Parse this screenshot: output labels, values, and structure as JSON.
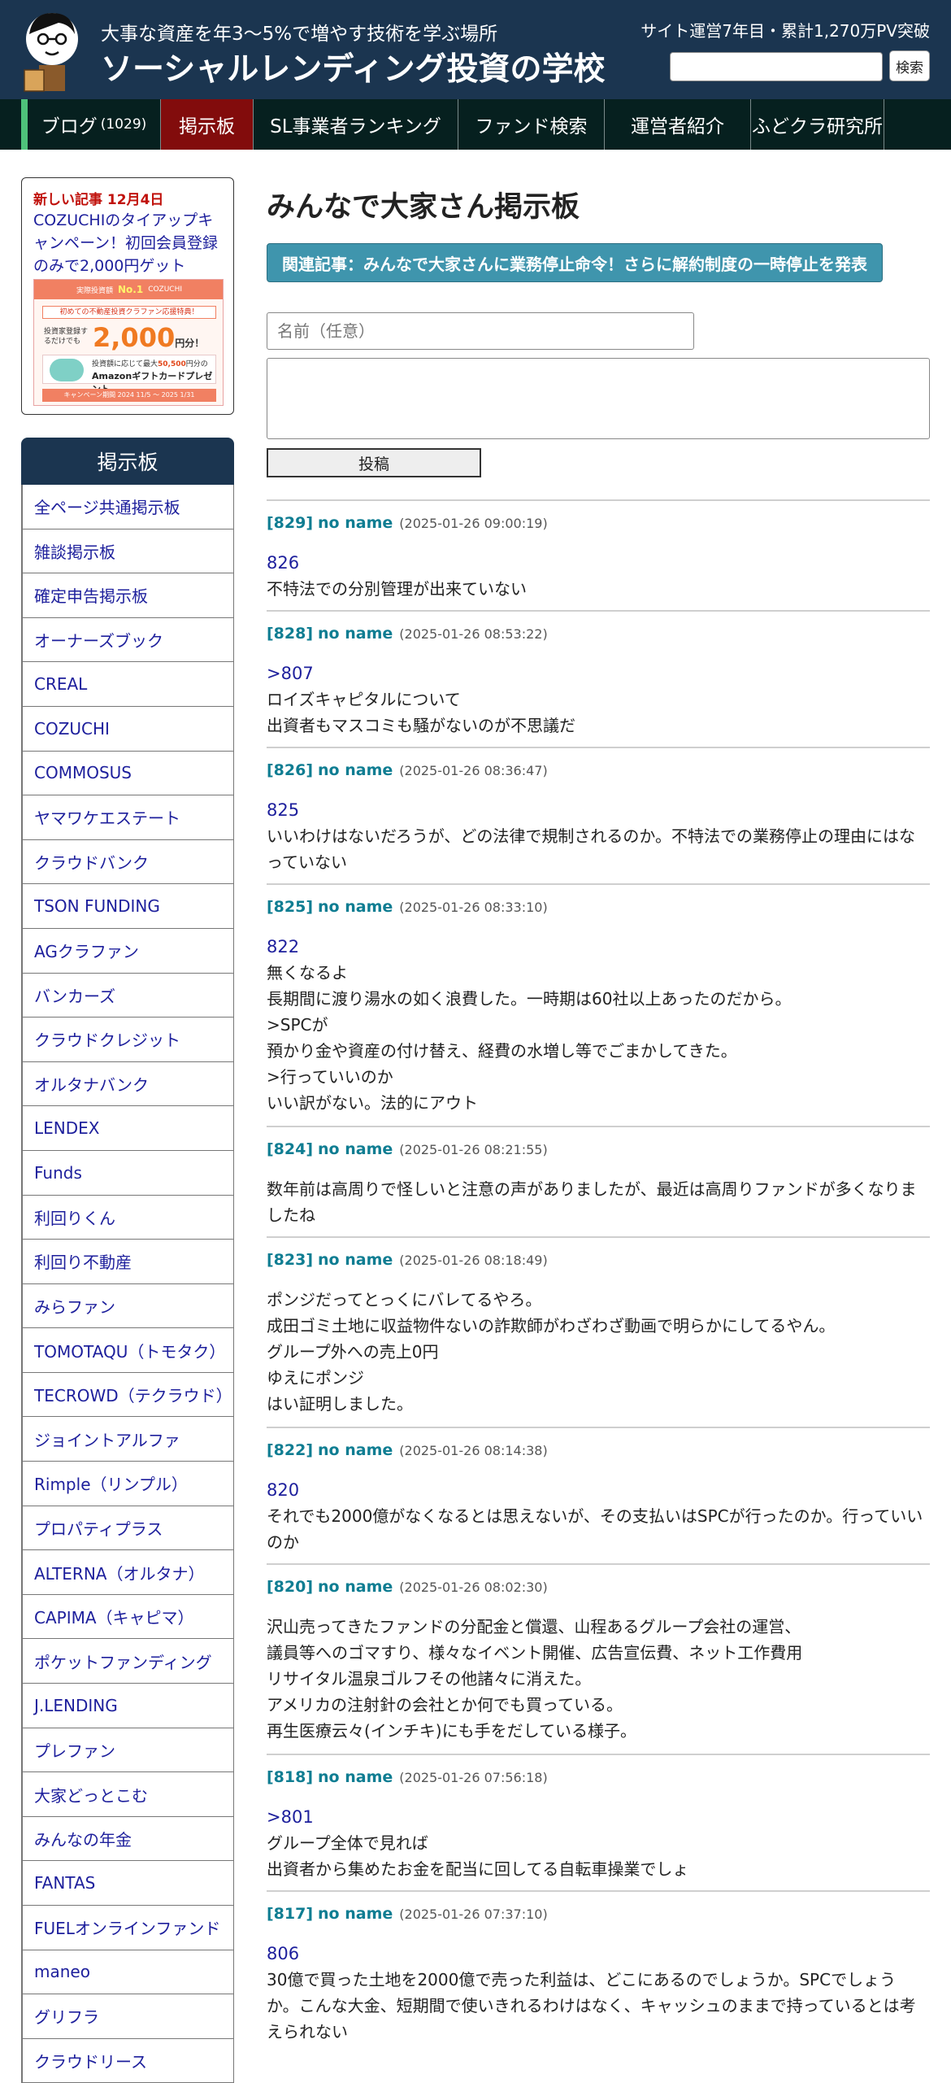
{
  "header": {
    "tagline": "大事な資産を年3〜5%で増やす技術を学ぶ場所",
    "site_title": "ソーシャルレンディング投資の学校",
    "stats": "サイト運営7年目・累計1,270万PV突破",
    "search_placeholder": "",
    "search_button": "検索"
  },
  "nav": {
    "items": [
      {
        "label": "ブログ",
        "count": "(1029)"
      },
      {
        "label": "掲示板",
        "active": true
      },
      {
        "label": "SL事業者ランキング"
      },
      {
        "label": "ファンド検索"
      },
      {
        "label": "運営者紹介"
      },
      {
        "label": "ふどクラ研究所"
      }
    ],
    "accent_color": "#4ec27a",
    "active_color": "#820c0c"
  },
  "sidebar": {
    "promo": {
      "date": "新しい記事 12月4日",
      "text": "COZUCHIのタイアップキャンペーン！初回会員登録のみで2,000円ゲット",
      "banner": {
        "top_small": "実際投資額",
        "top_badge": "No.1",
        "brand": "COZUCHI",
        "line": "初めての不動産投資クラファン応援特典！",
        "register_label": "投資家登録するだけでも",
        "amount": "2,000",
        "amount_unit": "円分！",
        "gift_line": "投資額に応じて最大",
        "gift_amount": "50,500",
        "gift_line2": "円分の",
        "gift_name": "Amazonギフトカードプレゼント",
        "footer": "キャンペーン期間 2024 11/5 〜 2025 1/31"
      }
    },
    "board": {
      "title": "掲示板",
      "items": [
        "全ページ共通掲示板",
        "雑談掲示板",
        "確定申告掲示板",
        "オーナーズブック",
        "CREAL",
        "COZUCHI",
        "COMMOSUS",
        "ヤマワケエステート",
        "クラウドバンク",
        "TSON FUNDING",
        "AGクラファン",
        "バンカーズ",
        "クラウドクレジット",
        "オルタナバンク",
        "LENDEX",
        "Funds",
        "利回りくん",
        "利回り不動産",
        "みらファン",
        "TOMOTAQU（トモタク）",
        "TECROWD（テクラウド）",
        "ジョイントアルファ",
        "Rimple（リンプル）",
        "プロパティプラス",
        "ALTERNA（オルタナ）",
        "CAPIMA（キャピマ）",
        "ポケットファンディング",
        "J.LENDING",
        "プレファン",
        "大家どっとこむ",
        "みんなの年金",
        "FANTAS",
        "FUELオンラインファンド",
        "maneo",
        "グリフラ",
        "クラウドリース"
      ]
    }
  },
  "main": {
    "title": "みんなで大家さん掲示板",
    "related": "関連記事：みんなで大家さんに業務停止命令！さらに解約制度の一時停止を発表",
    "name_placeholder": "名前（任意）",
    "post_button": "投稿",
    "comments": [
      {
        "id": "[829]",
        "name": "no name",
        "date": "(2025-01-26 09:00:19)",
        "ref": "826",
        "lines": [
          "不特法での分別管理が出来ていない"
        ]
      },
      {
        "id": "[828]",
        "name": "no name",
        "date": "(2025-01-26 08:53:22)",
        "ref": ">807",
        "lines": [
          "ロイズキャピタルについて",
          "出資者もマスコミも騒がないのが不思議だ"
        ]
      },
      {
        "id": "[826]",
        "name": "no name",
        "date": "(2025-01-26 08:36:47)",
        "ref": "825",
        "lines": [
          "いいわけはないだろうが、どの法律で規制されるのか。不特法での業務停止の理由にはな",
          "っていない"
        ]
      },
      {
        "id": "[825]",
        "name": "no name",
        "date": "(2025-01-26 08:33:10)",
        "ref": "822",
        "lines": [
          "無くなるよ",
          "長期間に渡り湯水の如く浪費した。一時期は60社以上あったのだから。",
          ">SPCが",
          "預かり金や資産の付け替え、経費の水増し等でごまかしてきた。",
          ">行っていいのか",
          "いい訳がない。法的にアウト"
        ]
      },
      {
        "id": "[824]",
        "name": "no name",
        "date": "(2025-01-26 08:21:55)",
        "ref": "",
        "lines": [
          "数年前は高周りで怪しいと注意の声がありましたが、最近は高周りファンドが多くなりま",
          "したね"
        ]
      },
      {
        "id": "[823]",
        "name": "no name",
        "date": "(2025-01-26 08:18:49)",
        "ref": "",
        "lines": [
          "ポンジだってとっくにバレてるやろ。",
          "成田ゴミ土地に収益物件ないの詐欺師がわざわざ動画で明らかにしてるやん。",
          "グループ外への売上0円",
          "ゆえにポンジ",
          "はい証明しました。"
        ]
      },
      {
        "id": "[822]",
        "name": "no name",
        "date": "(2025-01-26 08:14:38)",
        "ref": "820",
        "lines": [
          "それでも2000億がなくなるとは思えないが、その支払いはSPCが行ったのか。行っていい",
          "のか"
        ]
      },
      {
        "id": "[820]",
        "name": "no name",
        "date": "(2025-01-26 08:02:30)",
        "ref": "",
        "lines": [
          "沢山売ってきたファンドの分配金と償還、山程あるグループ会社の運営、",
          "議員等へのゴマすり、様々なイベント開催、広告宣伝費、ネット工作費用",
          "リサイタル温泉ゴルフその他諸々に消えた。",
          "アメリカの注射針の会社とか何でも買っている。",
          "再生医療云々(インチキ)にも手をだしている様子。"
        ]
      },
      {
        "id": "[818]",
        "name": "no name",
        "date": "(2025-01-26 07:56:18)",
        "ref": ">801",
        "lines": [
          "グループ全体で見れば",
          "出資者から集めたお金を配当に回してる自転車操業でしょ"
        ]
      },
      {
        "id": "[817]",
        "name": "no name",
        "date": "(2025-01-26 07:37:10)",
        "ref": "806",
        "lines": [
          "30億で買った土地を2000億で売った利益は、どこにあるのでしょうか。SPCでしょう",
          "か。こんな大金、短期間で使いきれるわけはなく、キャッシュのままで持っているとは考",
          "えられない"
        ]
      }
    ]
  }
}
